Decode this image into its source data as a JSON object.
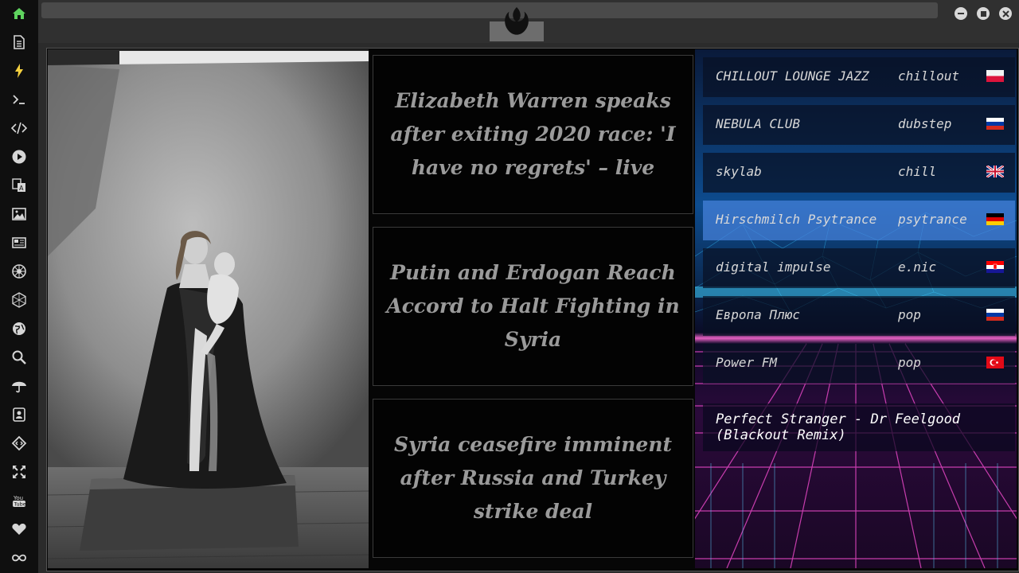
{
  "sidebar": {
    "items": [
      {
        "icon": "home-icon",
        "color": "#5fd35f"
      },
      {
        "icon": "document-icon",
        "color": "#d6d6d6"
      },
      {
        "icon": "lightning-icon",
        "color": "#f4d03f"
      },
      {
        "icon": "terminal-icon",
        "color": "#d6d6d6"
      },
      {
        "icon": "code-icon",
        "color": "#d6d6d6"
      },
      {
        "icon": "play-icon",
        "color": "#d6d6d6"
      },
      {
        "icon": "translate-icon",
        "color": "#d6d6d6"
      },
      {
        "icon": "image-icon",
        "color": "#d6d6d6"
      },
      {
        "icon": "newspaper-icon",
        "color": "#d6d6d6"
      },
      {
        "icon": "rebel-alliance-icon",
        "color": "#d6d6d6"
      },
      {
        "icon": "hexagon-network-icon",
        "color": "#d6d6d6"
      },
      {
        "icon": "globe-icon",
        "color": "#d6d6d6"
      },
      {
        "icon": "search-icon",
        "color": "#d6d6d6"
      },
      {
        "icon": "umbrella-icon",
        "color": "#d6d6d6"
      },
      {
        "icon": "contact-card-icon",
        "color": "#d6d6d6"
      },
      {
        "icon": "diamond-code-icon",
        "color": "#d6d6d6"
      },
      {
        "icon": "expand-arrows-icon",
        "color": "#d6d6d6"
      },
      {
        "icon": "youtube-icon",
        "color": "#d6d6d6"
      },
      {
        "icon": "heart-icon",
        "color": "#d6d6d6"
      },
      {
        "icon": "infinity-icon",
        "color": "#d6d6d6"
      }
    ]
  },
  "window": {
    "logo_icon": "rebel-alliance-logo",
    "buttons": [
      "minimize-icon",
      "maximize-icon",
      "close-icon"
    ]
  },
  "news": [
    {
      "headline": "Elizabeth Warren speaks after exiting 2020 race: 'I have no regrets' – live"
    },
    {
      "headline": "Putin and Erdogan Reach Accord to Halt Fighting in Syria"
    },
    {
      "headline": "Syria ceasefire imminent after Russia and Turkey strike deal"
    }
  ],
  "radio": {
    "stations": [
      {
        "name": "CHILLOUT LOUNGE JAZZ",
        "genre": "chillout",
        "flag": "poland",
        "active": false
      },
      {
        "name": "NEBULA CLUB",
        "genre": "dubstep",
        "flag": "russia",
        "active": false
      },
      {
        "name": "skylab",
        "genre": "chill",
        "flag": "united-kingdom",
        "active": false
      },
      {
        "name": "Hirschmilch Psytrance",
        "genre": "psytrance",
        "flag": "germany",
        "active": true
      },
      {
        "name": "digital impulse",
        "genre": "e.nic",
        "flag": "croatia",
        "active": false
      },
      {
        "name": "Европа Плюс",
        "genre": "pop",
        "flag": "russia",
        "active": false
      },
      {
        "name": "Power FM",
        "genre": "pop",
        "flag": "turkey",
        "active": false
      }
    ],
    "now_playing": "Perfect Stranger - Dr Feelgood (Blackout Remix)"
  },
  "colors": {
    "accent_active_station": "#4a86d8",
    "home_icon": "#5fd35f",
    "lightning_icon": "#f4d03f"
  }
}
